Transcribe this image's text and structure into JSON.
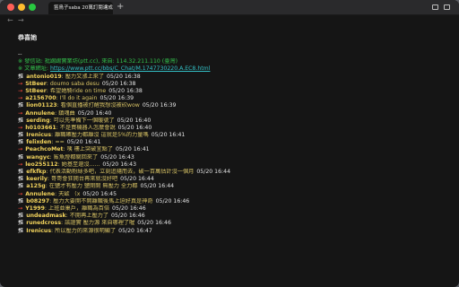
{
  "tab": {
    "title": "笛鳥子saba 20萬訂閱達成",
    "close": "×",
    "new_tab": "+"
  },
  "nav": {
    "back": "←",
    "forward": "→"
  },
  "article": {
    "heading": "恭喜她",
    "separator": "--",
    "from_line": "※ 發信站: 批踢踢實業坊(ptt.cc), 來自: 114.32.211.110 (臺灣)",
    "url_prefix": "※ 文章網址: ",
    "url": "https://www.ptt.cc/bbs/C_Chat/M.1747730220.A.EC8.html"
  },
  "comments": [
    {
      "tag": "推",
      "arrow": false,
      "user": "antonio019",
      "text": ": 壓力又漲上來了",
      "time": "05/20 16:38"
    },
    {
      "tag": "→",
      "arrow": true,
      "user": "StBeer",
      "text": ": doumo saba desu",
      "time": "05/20 16:38"
    },
    {
      "tag": "→",
      "arrow": true,
      "user": "StBeer",
      "text": ": 希望她騎ride on time",
      "time": "05/20 16:38"
    },
    {
      "tag": "→",
      "arrow": true,
      "user": "a2156700",
      "text": ": I'll do it again",
      "time": "05/20 16:39"
    },
    {
      "tag": "推",
      "arrow": false,
      "user": "lion01123",
      "text": ": 看個直播被打醒我想沒被砍wow",
      "time": "05/20 16:39"
    },
    {
      "tag": "→",
      "arrow": true,
      "user": "Annulene",
      "text": ": 鎮魂曲",
      "time": "05/20 16:40"
    },
    {
      "tag": "推",
      "arrow": false,
      "user": "serding",
      "text": ": 可以先準備下一個暖號了",
      "time": "05/20 16:40"
    },
    {
      "tag": "→",
      "arrow": true,
      "user": "h0103661",
      "text": ": 不是買機器人怎麼會說",
      "time": "05/20 16:40"
    },
    {
      "tag": "推",
      "arrow": false,
      "user": "Irenicus",
      "text": ": 離職確壓力都離沒 這就是5%的力量嗎",
      "time": "05/20 16:41"
    },
    {
      "tag": "推",
      "arrow": false,
      "user": "felixden",
      "text": ": ==",
      "time": "05/20 16:41"
    },
    {
      "tag": "→",
      "arrow": true,
      "user": "PeachcoMet",
      "text": ": 咦 樓上突破宜點了",
      "time": "05/20 16:41"
    },
    {
      "tag": "推",
      "arrow": false,
      "user": "wangyc",
      "text": ": 鯊魚燈都關回來了",
      "time": "05/20 16:43"
    },
    {
      "tag": "→",
      "arrow": true,
      "user": "leo255112",
      "text": ": 她基至還沒......",
      "time": "05/20 16:43"
    },
    {
      "tag": "推",
      "arrow": false,
      "user": "efkfkp",
      "text": ": 代表活動粉絲多吧，立刻追隨而去，破一百萬估計沒一個月",
      "time": "05/20 16:44"
    },
    {
      "tag": "推",
      "arrow": false,
      "user": "keerily",
      "text": ": 哥哥會狂開台再來就沒好吧",
      "time": "05/20 16:44"
    },
    {
      "tag": "推",
      "arrow": false,
      "user": "a125g",
      "text": ": 在鹽才有壓力 鹽開開 無壓力 全力都",
      "time": "05/20 16:44"
    },
    {
      "tag": "→",
      "arrow": true,
      "user": "Annulene",
      "text": ": 天歐 （x",
      "time": "05/20 16:45"
    },
    {
      "tag": "推",
      "arrow": false,
      "user": "b08297",
      "text": ": 壓力大要開不開離職後馬上迫好真是神奇",
      "time": "05/20 16:46"
    },
    {
      "tag": "→",
      "arrow": true,
      "user": "Y1999",
      "text": ": 上班並巢戶，離職為百倍",
      "time": "05/20 16:46"
    },
    {
      "tag": "推",
      "arrow": false,
      "user": "undeadmask",
      "text": ": 不開再上壓力了",
      "time": "05/20 16:46"
    },
    {
      "tag": "推",
      "arrow": false,
      "user": "runedcross",
      "text": ": 該證實 壓力源 來自哪裡了喔",
      "time": "05/20 16:46"
    },
    {
      "tag": "推",
      "arrow": false,
      "user": "Irenicus",
      "text": ": 所以壓力的來源很明顯了",
      "time": "05/20 16:47"
    }
  ],
  "colors": {
    "background": "#151515",
    "userid": "#f2d35c",
    "comment_text": "#d7c264",
    "system_green": "#33c24d",
    "link": "#33c0c6",
    "arrow_red": "#ff4b3e"
  }
}
